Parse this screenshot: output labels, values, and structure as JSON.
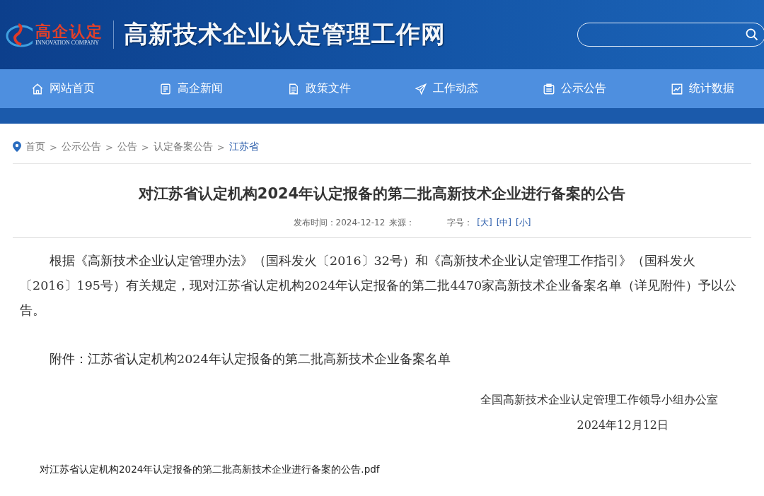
{
  "header": {
    "logo_text": "高企认定",
    "logo_subtext": "INNOVATION COMPANY",
    "site_title": "高新技术企业认定管理工作网"
  },
  "nav": [
    {
      "label": "网站首页"
    },
    {
      "label": "高企新闻"
    },
    {
      "label": "政策文件"
    },
    {
      "label": "工作动态"
    },
    {
      "label": "公示公告"
    },
    {
      "label": "统计数据"
    }
  ],
  "breadcrumb": [
    {
      "label": "首页",
      "current": false
    },
    {
      "label": "公示公告",
      "current": false
    },
    {
      "label": "公告",
      "current": false
    },
    {
      "label": "认定备案公告",
      "current": false
    },
    {
      "label": "江苏省",
      "current": true
    }
  ],
  "breadcrumb_separator": ">",
  "article": {
    "title": "对江苏省认定机构2024年认定报备的第二批高新技术企业进行备案的公告",
    "meta": {
      "date": "发布时间：2024-12-12",
      "source": "来源：",
      "font_size_label": "字号：",
      "font_sizes": [
        "[大]",
        "[中]",
        "[小]"
      ]
    },
    "paragraphs": [
      "根据《高新技术企业认定管理办法》（国科发火〔2016〕32号）和《高新技术企业认定管理工作指引》（国科发火〔2016〕195号）有关规定，现对江苏省认定机构2024年认定报备的第二批4470家高新技术企业备案名单（详见附件）予以公告。",
      "附件：江苏省认定机构2024年认定报备的第二批高新技术企业备案名单"
    ],
    "signature": [
      "全国高新技术企业认定管理工作领导小组办公室",
      "2024年12月12日"
    ],
    "attachment": "对江苏省认定机构2024年认定报备的第二批高新技术企业进行备案的公告.pdf"
  }
}
